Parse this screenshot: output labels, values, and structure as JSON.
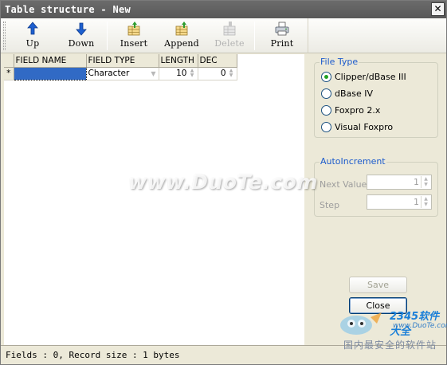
{
  "window": {
    "title": "Table structure - New",
    "close_glyph": "✕"
  },
  "toolbar": {
    "buttons": [
      {
        "label": "Up",
        "icon": "arrow-up-icon",
        "enabled": true
      },
      {
        "label": "Down",
        "icon": "arrow-down-icon",
        "enabled": true
      },
      {
        "label": "Insert",
        "icon": "insert-row-icon",
        "enabled": true
      },
      {
        "label": "Append",
        "icon": "append-row-icon",
        "enabled": true
      },
      {
        "label": "Delete",
        "icon": "delete-row-icon",
        "enabled": false
      },
      {
        "label": "Print",
        "icon": "printer-icon",
        "enabled": true
      }
    ]
  },
  "grid": {
    "columns": [
      "FIELD NAME",
      "FIELD TYPE",
      "LENGTH",
      "DEC"
    ],
    "rows": [
      {
        "marker": "*",
        "field_name": "",
        "field_type": "Character",
        "length": "10",
        "dec": "0"
      }
    ]
  },
  "file_type": {
    "legend": "File Type",
    "options": [
      "Clipper/dBase III",
      "dBase IV",
      "Foxpro 2.x",
      "Visual Foxpro"
    ],
    "selected_index": 0
  },
  "autoincrement": {
    "legend": "AutoIncrement",
    "next_value_label": "Next Value",
    "next_value": "1",
    "step_label": "Step",
    "step": "1"
  },
  "buttons": {
    "save": "Save",
    "close": "Close"
  },
  "status": {
    "text": "Fields : 0, Record size : 1 bytes"
  },
  "watermark": {
    "main": "www.DuoTe.com",
    "logo_text": "2345软件大全",
    "logo_url": "www.DuoTe.com",
    "logo_caption": "国内最安全的软件站"
  },
  "colors": {
    "title_bar": "#585858",
    "selection": "#316ac5",
    "legend_blue": "#1c5bcc",
    "radio_dot": "#21a121"
  }
}
